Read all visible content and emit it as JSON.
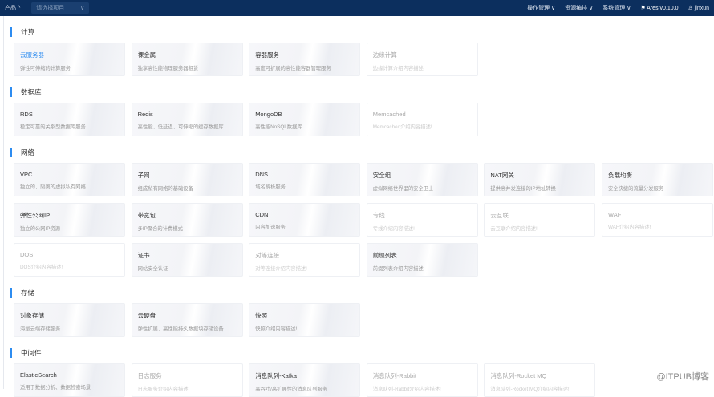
{
  "topbar": {
    "product": "产品 ^",
    "project_placeholder": "请选择项目",
    "menus": [
      "操作管理 ∨",
      "资源编排 ∨",
      "系统管理 ∨"
    ],
    "version": "⚑ Ares.v0.10.0",
    "user": "♙ jinxun"
  },
  "sections": [
    {
      "title": "计算",
      "items": [
        {
          "t": "云服务器",
          "d": "弹性可伸缩的计算服务",
          "s": "active"
        },
        {
          "t": "裸金属",
          "d": "独享高性能物理服务器租赁"
        },
        {
          "t": "容器服务",
          "d": "高度可扩展的高性能容器管理服务"
        },
        {
          "t": "边缘计算",
          "d": "边缘计算介绍内容描述!",
          "s": "disabled"
        }
      ]
    },
    {
      "title": "数据库",
      "items": [
        {
          "t": "RDS",
          "d": "稳定可靠的关系型数据库服务"
        },
        {
          "t": "Redis",
          "d": "高性能、低延迟、可伸缩的缓存数据库"
        },
        {
          "t": "MongoDB",
          "d": "高性能NoSQL数据库"
        },
        {
          "t": "Memcached",
          "d": "Memcached介绍内容描述!",
          "s": "disabled"
        }
      ]
    },
    {
      "title": "网络",
      "items": [
        {
          "t": "VPC",
          "d": "独立的、隔离的虚拟私有网络"
        },
        {
          "t": "子网",
          "d": "组成私有网络的基础设备"
        },
        {
          "t": "DNS",
          "d": "域名解析服务"
        },
        {
          "t": "安全组",
          "d": "虚拟网络世界里的安全卫士"
        },
        {
          "t": "NAT网关",
          "d": "提供高并发连接的IP地址转换"
        },
        {
          "t": "负载均衡",
          "d": "安全快捷的流量分发服务"
        },
        {
          "t": "弹性公网IP",
          "d": "独立的公网IP资源"
        },
        {
          "t": "带宽包",
          "d": "多IP聚合的计费模式"
        },
        {
          "t": "CDN",
          "d": "内容加速服务"
        },
        {
          "t": "专线",
          "d": "专线介绍内容描述!",
          "s": "disabled"
        },
        {
          "t": "云互联",
          "d": "云互联介绍内容描述!",
          "s": "disabled"
        },
        {
          "t": "WAF",
          "d": "WAF介绍内容描述!",
          "s": "disabled"
        },
        {
          "t": "DOS",
          "d": "DOS介绍内容描述!",
          "s": "disabled"
        },
        {
          "t": "证书",
          "d": "网站安全认证"
        },
        {
          "t": "对等连接",
          "d": "对等连接介绍内容描述!",
          "s": "disabled"
        },
        {
          "t": "前缀列表",
          "d": "前缀列表介绍内容描述!"
        }
      ]
    },
    {
      "title": "存储",
      "items": [
        {
          "t": "对象存储",
          "d": "海量云端存储服务"
        },
        {
          "t": "云硬盘",
          "d": "弹性扩展、高性能持久数据块存储设备"
        },
        {
          "t": "快照",
          "d": "快照介绍内容描述!"
        }
      ]
    },
    {
      "title": "中间件",
      "items": [
        {
          "t": "ElasticSearch",
          "d": "适用于数据分析、数据检索场景"
        },
        {
          "t": "日志服务",
          "d": "日志服务介绍内容描述!",
          "s": "disabled"
        },
        {
          "t": "消息队列-Kafka",
          "d": "高吞吐/高扩展性的消息队列服务"
        },
        {
          "t": "消息队列-Rabbit",
          "d": "消息队列-Rabbit介绍内容描述!",
          "s": "disabled"
        },
        {
          "t": "消息队列-Rocket MQ",
          "d": "消息队列-Rocket MQ介绍内容描述!",
          "s": "disabled"
        }
      ]
    }
  ],
  "watermark": "@ITPUB博客"
}
